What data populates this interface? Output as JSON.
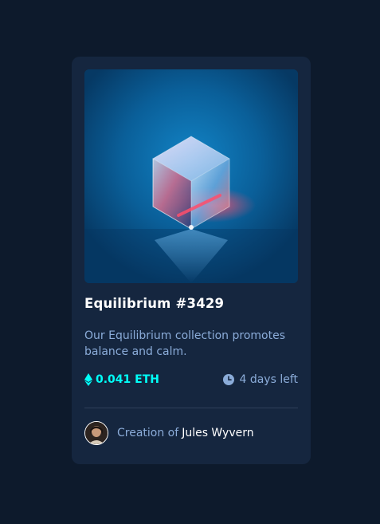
{
  "card": {
    "title": "Equilibrium #3429",
    "description": "Our Equilibrium collection promotes balance and calm.",
    "price": "0.041 ETH",
    "time_left": "4 days left",
    "creation_prefix": "Creation of",
    "creator_name": "Jules Wyvern"
  },
  "icons": {
    "price": "ethereum-icon",
    "time": "clock-icon"
  },
  "colors": {
    "page_background": "#0d1a2c",
    "card_background": "#15263f",
    "accent_cyan": "#00fff8",
    "soft_blue_text": "#8bacd9",
    "white_text": "#ffffff",
    "divider": "#2e405a"
  }
}
